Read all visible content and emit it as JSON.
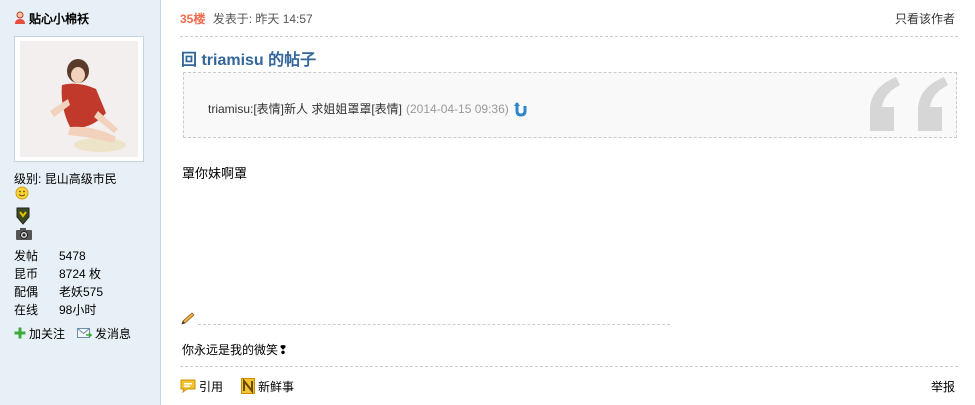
{
  "author": {
    "name": "贴心小棉袄",
    "icon": "female-user-icon"
  },
  "profile": {
    "level_label": "级别:",
    "level_value": "昆山高级市民",
    "stats": [
      {
        "label": "发帖",
        "value": "5478"
      },
      {
        "label": "昆币",
        "value": "8724 枚"
      },
      {
        "label": "配偶",
        "value": "老妖575"
      },
      {
        "label": "在线",
        "value": "98小时"
      }
    ],
    "actions": {
      "follow": "加关注",
      "message": "发消息"
    }
  },
  "post": {
    "floor": "35楼",
    "posted_label": "发表于: 昨天 14:57",
    "only_author": "只看该作者",
    "title": "回 triamisu 的帖子",
    "quote": {
      "text": "triamisu:[表情]新人  求姐姐罩罩[表情]",
      "time": "(2014-04-15 09:36)"
    },
    "content": "罩你妹啊罩",
    "signature": "你永远是我的微笑❢"
  },
  "footer": {
    "quote_label": "引用",
    "fresh_label": "新鲜事",
    "report_label": "举报"
  },
  "colors": {
    "floor": "#f26c4f",
    "title": "#336699",
    "sidebar_bg": "#e8f0f7"
  }
}
